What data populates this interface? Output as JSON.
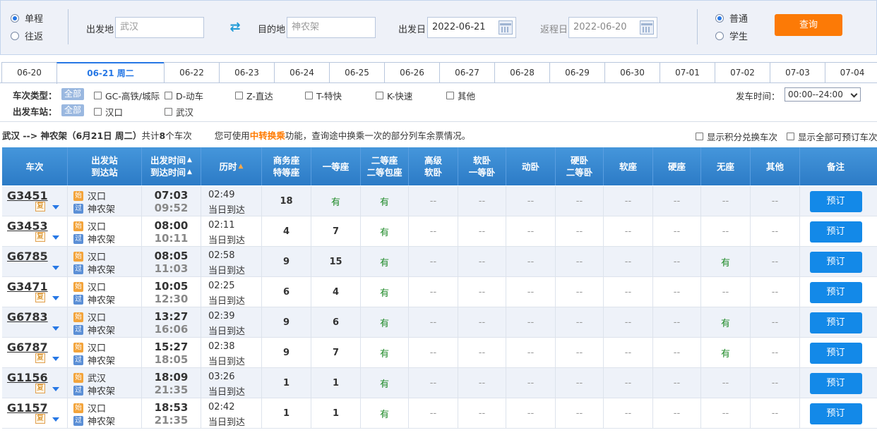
{
  "search": {
    "trip_types": [
      {
        "label": "单程",
        "checked": true
      },
      {
        "label": "往返",
        "checked": false
      }
    ],
    "from_label": "出发地",
    "from_placeholder": "武汉",
    "to_label": "目的地",
    "to_placeholder": "神农架",
    "depart_label": "出发日",
    "depart_value": "2022-06-21",
    "return_label": "返程日",
    "return_value": "2022-06-20",
    "passenger_types": [
      {
        "label": "普通",
        "checked": true
      },
      {
        "label": "学生",
        "checked": false
      }
    ],
    "query_button": "查询"
  },
  "date_tabs": [
    "06-20",
    "06-21 周二",
    "06-22",
    "06-23",
    "06-24",
    "06-25",
    "06-26",
    "06-27",
    "06-28",
    "06-29",
    "06-30",
    "07-01",
    "07-02",
    "07-03",
    "07-04"
  ],
  "filters": {
    "type_label": "车次类型：",
    "all_label": "全部",
    "types": [
      "GC-高铁/城际",
      "D-动车",
      "Z-直达",
      "T-特快",
      "K-快速",
      "其他"
    ],
    "station_label": "出发车站：",
    "stations": [
      "汉口",
      "武汉"
    ],
    "depart_time_label": "发车时间：",
    "depart_time_value": "00:00--24:00"
  },
  "info": {
    "route": "武汉 --> 神农架（6月21日  周二）",
    "count_prefix": "共计",
    "count": "8",
    "count_suffix": "个车次",
    "hint_prefix": "您可使用",
    "hint_link": "中转换乘",
    "hint_suffix": "功能，查询途中换乘一次的部分列车余票情况。",
    "option1": "显示积分兑换车次",
    "option2": "显示全部可预订车次"
  },
  "table": {
    "headers": [
      [
        "车次"
      ],
      [
        "出发站",
        "到达站"
      ],
      [
        "出发时间",
        "到达时间"
      ],
      [
        "历时"
      ],
      [
        "商务座",
        "特等座"
      ],
      [
        "一等座"
      ],
      [
        "二等座",
        "二等包座"
      ],
      [
        "高级",
        "软卧"
      ],
      [
        "软卧",
        "一等卧"
      ],
      [
        "动卧"
      ],
      [
        "硬卧",
        "二等卧"
      ],
      [
        "软座"
      ],
      [
        "硬座"
      ],
      [
        "无座"
      ],
      [
        "其他"
      ],
      [
        "备注"
      ]
    ],
    "fu_icon": "复",
    "start_icon": "始",
    "pass_icon": "过",
    "book_label": "预订",
    "rows": [
      {
        "train": "G3451",
        "fu": true,
        "from": "汉口",
        "to": "神农架",
        "dep": "07:03",
        "arr": "09:52",
        "dur": "02:49",
        "day": "当日到达",
        "seats": [
          "18",
          "有",
          "有",
          "--",
          "--",
          "--",
          "--",
          "--",
          "--",
          "--",
          "--"
        ]
      },
      {
        "train": "G3453",
        "fu": true,
        "from": "汉口",
        "to": "神农架",
        "dep": "08:00",
        "arr": "10:11",
        "dur": "02:11",
        "day": "当日到达",
        "seats": [
          "4",
          "7",
          "有",
          "--",
          "--",
          "--",
          "--",
          "--",
          "--",
          "--",
          "--"
        ]
      },
      {
        "train": "G6785",
        "fu": false,
        "from": "汉口",
        "to": "神农架",
        "dep": "08:05",
        "arr": "11:03",
        "dur": "02:58",
        "day": "当日到达",
        "seats": [
          "9",
          "15",
          "有",
          "--",
          "--",
          "--",
          "--",
          "--",
          "--",
          "有",
          "--"
        ]
      },
      {
        "train": "G3471",
        "fu": true,
        "from": "汉口",
        "to": "神农架",
        "dep": "10:05",
        "arr": "12:30",
        "dur": "02:25",
        "day": "当日到达",
        "seats": [
          "6",
          "4",
          "有",
          "--",
          "--",
          "--",
          "--",
          "--",
          "--",
          "--",
          "--"
        ]
      },
      {
        "train": "G6783",
        "fu": false,
        "from": "汉口",
        "to": "神农架",
        "dep": "13:27",
        "arr": "16:06",
        "dur": "02:39",
        "day": "当日到达",
        "seats": [
          "9",
          "6",
          "有",
          "--",
          "--",
          "--",
          "--",
          "--",
          "--",
          "有",
          "--"
        ]
      },
      {
        "train": "G6787",
        "fu": true,
        "from": "汉口",
        "to": "神农架",
        "dep": "15:27",
        "arr": "18:05",
        "dur": "02:38",
        "day": "当日到达",
        "seats": [
          "9",
          "7",
          "有",
          "--",
          "--",
          "--",
          "--",
          "--",
          "--",
          "有",
          "--"
        ]
      },
      {
        "train": "G1156",
        "fu": true,
        "from": "武汉",
        "to": "神农架",
        "dep": "18:09",
        "arr": "21:35",
        "dur": "03:26",
        "day": "当日到达",
        "seats": [
          "1",
          "1",
          "有",
          "--",
          "--",
          "--",
          "--",
          "--",
          "--",
          "--",
          "--"
        ]
      },
      {
        "train": "G1157",
        "fu": true,
        "from": "汉口",
        "to": "神农架",
        "dep": "18:53",
        "arr": "21:35",
        "dur": "02:42",
        "day": "当日到达",
        "seats": [
          "1",
          "1",
          "有",
          "--",
          "--",
          "--",
          "--",
          "--",
          "--",
          "--",
          "--"
        ]
      }
    ]
  }
}
